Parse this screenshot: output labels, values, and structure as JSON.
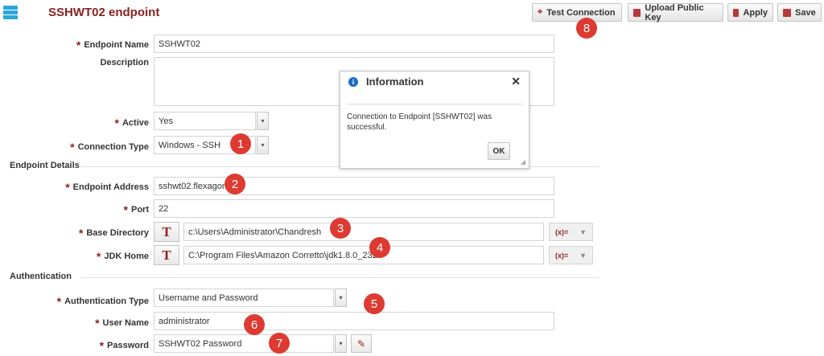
{
  "header": {
    "title": "SSHWT02 endpoint",
    "icon": "server-stack-icon"
  },
  "toolbar": {
    "test_connection": "Test Connection",
    "upload_key": "Upload Public Key",
    "apply": "Apply",
    "save": "Save"
  },
  "form": {
    "endpoint_name": {
      "label": "Endpoint Name",
      "value": "SSHWT02"
    },
    "description": {
      "label": "Description",
      "value": ""
    },
    "active": {
      "label": "Active",
      "value": "Yes"
    },
    "connection_type": {
      "label": "Connection Type",
      "value": "Windows - SSH"
    }
  },
  "details": {
    "section_title": "Endpoint Details",
    "address": {
      "label": "Endpoint Address",
      "value": "sshwt02.flexagon"
    },
    "port": {
      "label": "Port",
      "value": "22"
    },
    "base_dir": {
      "label": "Base Directory",
      "value": "c:\\Users\\Administrator\\Chandresh"
    },
    "jdk_home": {
      "label": "JDK Home",
      "value": "C:\\Program Files\\Amazon Corretto\\jdk1.8.0_232"
    },
    "type_toggle": "T",
    "expr_label": "(x)="
  },
  "auth": {
    "section_title": "Authentication",
    "type": {
      "label": "Authentication Type",
      "value": "Username and Password"
    },
    "user": {
      "label": "User Name",
      "value": "administrator"
    },
    "password": {
      "label": "Password",
      "value": "SSHWT02 Password"
    }
  },
  "dialog": {
    "title": "Information",
    "message": "Connection to Endpoint [SSHWT02] was successful.",
    "ok": "OK",
    "close": "✕"
  },
  "callouts": [
    "1",
    "2",
    "3",
    "4",
    "5",
    "6",
    "7",
    "8"
  ],
  "colors": {
    "accent": "#8b1f1f",
    "badge": "#dd3a31",
    "info": "#1c6cc4"
  }
}
